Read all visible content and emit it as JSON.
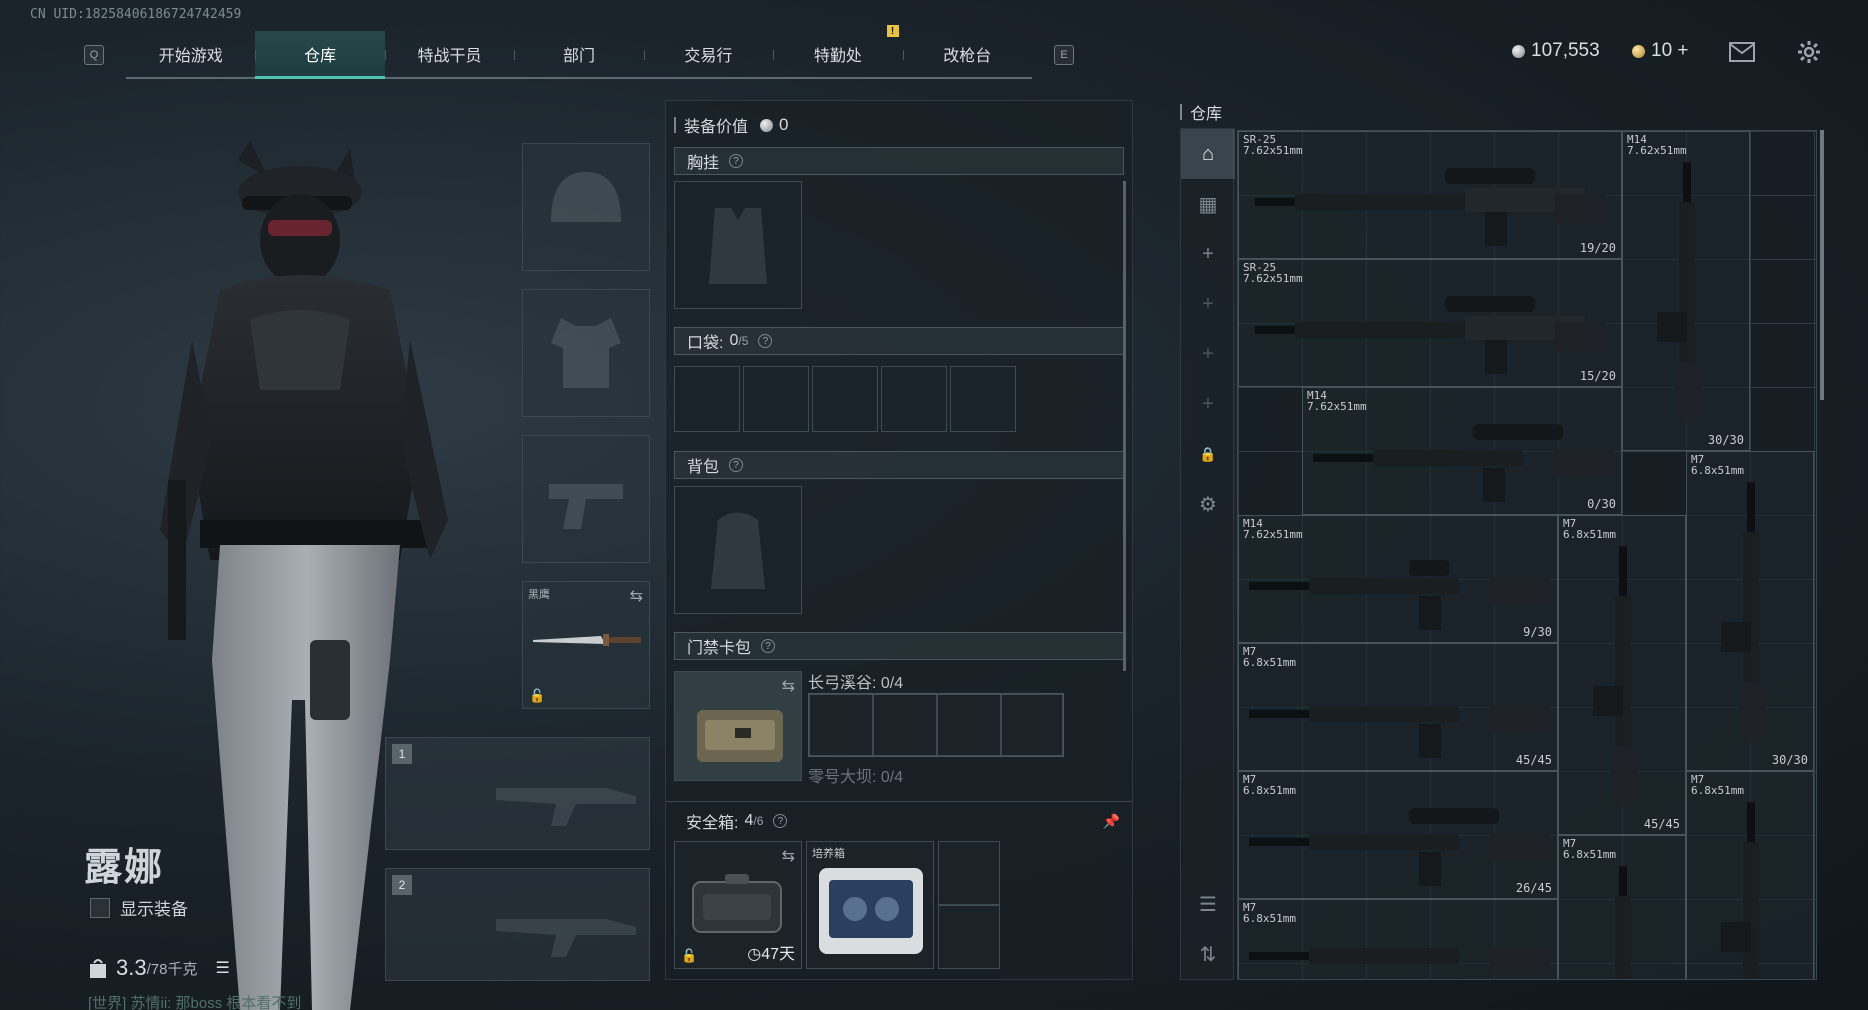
{
  "uid": "CN UID:18258406186724742459 ",
  "nav": {
    "key_left": "Q",
    "key_right": "E",
    "tabs": [
      {
        "label": "开始游戏"
      },
      {
        "label": "仓库",
        "active": true
      },
      {
        "label": "特战干员"
      },
      {
        "label": "部门"
      },
      {
        "label": "交易行"
      },
      {
        "label": "特勤处",
        "alert": "!"
      },
      {
        "label": "改枪台"
      }
    ]
  },
  "currency": {
    "silver": "107,553",
    "gold": "10 +"
  },
  "icons": {
    "mail": "mail-icon",
    "settings": "gear-icon"
  },
  "character": {
    "name": "露娜",
    "show_equipment_label": "显示装备",
    "weight_value": "3.3",
    "weight_max": "/78千克",
    "chat_channel": "[世界]",
    "chat_text": "苏情ii: 那boss 根本看不到"
  },
  "gear": {
    "melee_label": "黑鹰",
    "weapon_slot_1": "1",
    "weapon_slot_2": "2"
  },
  "equipment": {
    "title": "装备价值",
    "value": "0",
    "chest_rig": "胸挂",
    "pockets": "口袋:",
    "pockets_count": "0",
    "pockets_max": "/5",
    "backpack": "背包",
    "keycard": "门禁卡包",
    "keycard_slot1": "长弓溪谷: 0/4",
    "keycard_slot2": "零号大坝: 0/4",
    "safe_box": "安全箱:",
    "safe_count": "4",
    "safe_max": "/6",
    "safe_timer": "47天",
    "incubator_label": "培养箱",
    "help_symbol": "?"
  },
  "warehouse": {
    "title": "仓库",
    "items": [
      {
        "name": "SR-25",
        "caliber": "7.62x51mm",
        "count": "19/20"
      },
      {
        "name": "M14",
        "caliber": "7.62x51mm",
        "count": "30/30"
      },
      {
        "name": "SR-25",
        "caliber": "7.62x51mm",
        "count": "15/20"
      },
      {
        "name": "M14",
        "caliber": "7.62x51mm",
        "count": "0/30"
      },
      {
        "name": "M7",
        "caliber": "6.8x51mm",
        "count": "30/30"
      },
      {
        "name": "M14",
        "caliber": "7.62x51mm",
        "count": "9/30"
      },
      {
        "name": "M7",
        "caliber": "6.8x51mm",
        "count": "45/45"
      },
      {
        "name": "M7",
        "caliber": "6.8x51mm",
        "count": "45/45"
      },
      {
        "name": "M7",
        "caliber": "6.8x51mm",
        "count": ""
      },
      {
        "name": "M7",
        "caliber": "6.8x51mm",
        "count": "26/45"
      },
      {
        "name": "M7",
        "caliber": "6.8x51mm",
        "count": ""
      },
      {
        "name": "M7",
        "caliber": "6.8x51mm",
        "count": ""
      }
    ]
  },
  "colors": {
    "accent": "#4fc2b2",
    "alert": "#e8c33b"
  }
}
